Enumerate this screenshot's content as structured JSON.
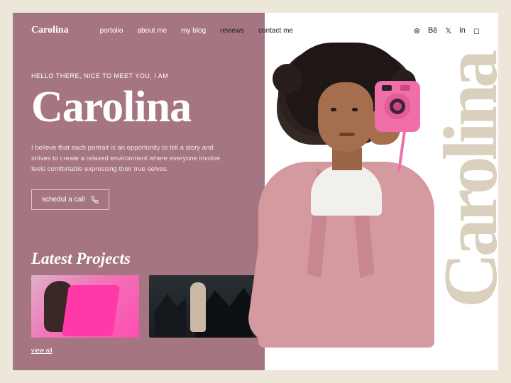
{
  "brand": "Carolina",
  "nav": {
    "portfolio": "portolio",
    "about": "about me",
    "blog": "my blog",
    "reviews": "reviews",
    "contact": "contact me"
  },
  "social_icons": {
    "dribbble": "dribbble",
    "behance": "behance",
    "twitter": "twitter",
    "linkedin": "linkedin",
    "instagram": "instagram"
  },
  "hero": {
    "eyebrow": "HELLO THERE, NICE TO MEET YOU, I AM",
    "name": "Carolina",
    "desc": "I believe that each portrait is an opportunity to tell a story and strives to create a relaxed environment where everyone involve feels comfortable expressing their true selves.",
    "cta": "schedul a call"
  },
  "projects": {
    "title": "Latest Projects",
    "view_all": "view all"
  },
  "bg_text": "Carolina",
  "colors": {
    "mauve": "#a67582",
    "cream": "#ede7d9",
    "pink": "#f06fa8",
    "blazer": "#d599a0"
  }
}
